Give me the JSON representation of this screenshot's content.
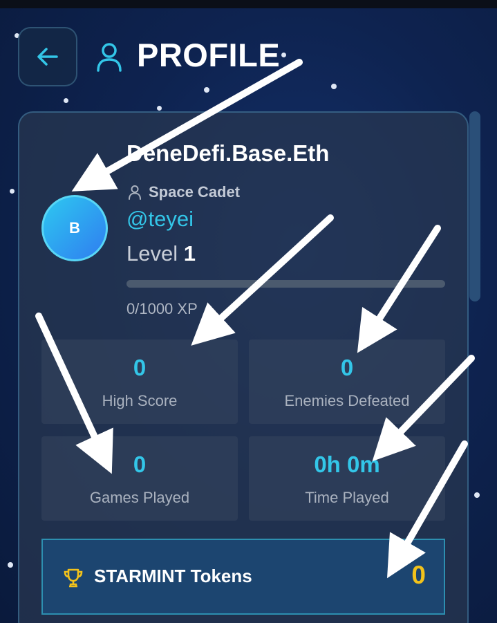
{
  "header": {
    "title": "PROFILE",
    "back_icon": "arrow-left-icon",
    "user_icon": "user-icon"
  },
  "profile": {
    "avatar_initial": "B",
    "display_name": "DeneDefi.Base.Eth",
    "rank": "Space Cadet",
    "handle": "@teyei",
    "level_label": "Level",
    "level_value": "1",
    "xp_text": "0/1000 XP",
    "xp_progress": 0
  },
  "stats": [
    {
      "value": "0",
      "label": "High Score"
    },
    {
      "value": "0",
      "label": "Enemies Defeated"
    },
    {
      "value": "0",
      "label": "Games Played"
    },
    {
      "value": "0h 0m",
      "label": "Time Played"
    }
  ],
  "tokens": {
    "label": "STARMINT Tokens",
    "value": "0",
    "icon": "trophy-icon"
  },
  "colors": {
    "accent": "#33c6e8",
    "gold": "#f2c21b",
    "background": "#0e2350"
  }
}
